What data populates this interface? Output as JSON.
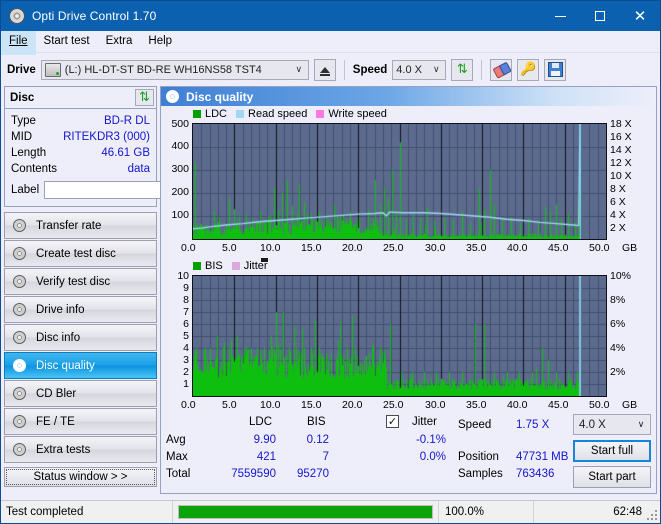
{
  "window": {
    "title": "Opti Drive Control 1.70",
    "icon": "disc-icon",
    "minimize": "—",
    "maximize": "□",
    "close": "✕"
  },
  "menu": {
    "items": [
      {
        "label": "File",
        "active": true
      },
      {
        "label": "Start test",
        "active": false
      },
      {
        "label": "Extra",
        "active": false
      },
      {
        "label": "Help",
        "active": false
      }
    ]
  },
  "toolbar": {
    "drive_label": "Drive",
    "drive_value": "(L:)   HL-DT-ST BD-RE  WH16NS58 TST4",
    "eject_title": "eject-button",
    "speed_label": "Speed",
    "speed_value": "4.0 X",
    "refresh_title": "refresh-button",
    "erase_title": "erase-button",
    "key_title": "key-button",
    "save_title": "save-button",
    "chevron": "∨"
  },
  "disc": {
    "header": "Disc",
    "refresh_title": "disc-refresh-button",
    "rows": [
      {
        "key": "Type",
        "value": "BD-R DL"
      },
      {
        "key": "MID",
        "value": "RITEKDR3 (000)"
      },
      {
        "key": "Length",
        "value": "46.61 GB"
      },
      {
        "key": "Contents",
        "value": "data"
      }
    ],
    "label_key": "Label",
    "label_value": "",
    "label_placeholder": ""
  },
  "nav": {
    "items": [
      {
        "label": "Transfer rate",
        "selected": false
      },
      {
        "label": "Create test disc",
        "selected": false
      },
      {
        "label": "Verify test disc",
        "selected": false
      },
      {
        "label": "Drive info",
        "selected": false
      },
      {
        "label": "Disc info",
        "selected": false
      },
      {
        "label": "Disc quality",
        "selected": true
      },
      {
        "label": "CD Bler",
        "selected": false
      },
      {
        "label": "FE / TE",
        "selected": false
      },
      {
        "label": "Extra tests",
        "selected": false
      }
    ],
    "status_button": "Status window > >"
  },
  "panel": {
    "title": "Disc quality"
  },
  "stats": {
    "col_ldc": "LDC",
    "col_bis": "BIS",
    "jitter_label": "Jitter",
    "jitter_checked": true,
    "jitter_check_glyph": "✓",
    "row_avg": "Avg",
    "row_max": "Max",
    "row_total": "Total",
    "avg_ldc": "9.90",
    "avg_bis": "0.12",
    "avg_jitter": "-0.1%",
    "max_ldc": "421",
    "max_bis": "7",
    "max_jitter": "0.0%",
    "total_ldc": "7559590",
    "total_bis": "95270",
    "speed_label": "Speed",
    "speed_value": "1.75 X",
    "position_label": "Position",
    "position_value": "47731 MB",
    "samples_label": "Samples",
    "samples_value": "763436",
    "speed_select": "4.0 X",
    "speed_select_chevron": "∨",
    "start_full": "Start full",
    "start_part": "Start part"
  },
  "statusbar": {
    "message": "Test completed",
    "percent": "100.0%",
    "percent_value": 100,
    "time": "62:48"
  },
  "colors": {
    "ldc": "#0fbf0f",
    "bis": "#0fbf0f",
    "read_speed": "#9fd8f5",
    "write_speed": "#ff79e0",
    "jitter": "#d8aadd",
    "plot_bg": "#5c6b8d",
    "grid": "#41506f",
    "grid_major": "#10101a",
    "title_bar": "#0b60b0",
    "accent": "#1515cd"
  },
  "chart_data": [
    {
      "id": "ldc-chart",
      "type": "area",
      "title": "LDC / Read speed",
      "legend": [
        {
          "label": "LDC",
          "color": "#00a000"
        },
        {
          "label": "Read speed",
          "color": "#9fd8f5"
        },
        {
          "label": "Write speed",
          "color": "#ff79e0"
        }
      ],
      "legend_position": "top-left",
      "xlabel": "GB",
      "xlim": [
        0,
        50
      ],
      "xticks": [
        "0.0",
        "5.0",
        "10.0",
        "15.0",
        "20.0",
        "25.0",
        "30.0",
        "35.0",
        "40.0",
        "45.0",
        "50.0"
      ],
      "ylabel_left": "LDC",
      "ylim": [
        0,
        500
      ],
      "yticks_left": [
        100,
        200,
        300,
        400,
        500
      ],
      "ylabel_right": "Speed",
      "ylim_right": [
        0,
        18
      ],
      "yticks_right": [
        "2 X",
        "4 X",
        "6 X",
        "8 X",
        "10 X",
        "12 X",
        "14 X",
        "16 X",
        "18 X"
      ],
      "data_end_gb": 46.8,
      "grid": true,
      "series": [
        {
          "name": "LDC",
          "color": "#0fbf0f",
          "kind": "spikes",
          "baseline_points": [
            {
              "x": 0.0,
              "y": 40
            },
            {
              "x": 2.0,
              "y": 42
            },
            {
              "x": 5.0,
              "y": 45
            },
            {
              "x": 8.0,
              "y": 48
            },
            {
              "x": 11.0,
              "y": 50
            },
            {
              "x": 14.0,
              "y": 52
            },
            {
              "x": 17.0,
              "y": 52
            },
            {
              "x": 20.0,
              "y": 55
            },
            {
              "x": 22.5,
              "y": 58
            },
            {
              "x": 23.2,
              "y": 20
            },
            {
              "x": 26.0,
              "y": 16
            },
            {
              "x": 30.0,
              "y": 15
            },
            {
              "x": 35.0,
              "y": 16
            },
            {
              "x": 40.0,
              "y": 14
            },
            {
              "x": 44.0,
              "y": 14
            },
            {
              "x": 46.8,
              "y": 12
            }
          ],
          "peaks": [
            {
              "x": 0.3,
              "y": 335
            },
            {
              "x": 2.6,
              "y": 120
            },
            {
              "x": 3.1,
              "y": 95
            },
            {
              "x": 4.4,
              "y": 175
            },
            {
              "x": 5.0,
              "y": 130
            },
            {
              "x": 5.6,
              "y": 98
            },
            {
              "x": 6.4,
              "y": 110
            },
            {
              "x": 7.2,
              "y": 90
            },
            {
              "x": 8.1,
              "y": 120
            },
            {
              "x": 9.1,
              "y": 100
            },
            {
              "x": 9.8,
              "y": 225
            },
            {
              "x": 10.3,
              "y": 120
            },
            {
              "x": 10.8,
              "y": 200
            },
            {
              "x": 11.4,
              "y": 258
            },
            {
              "x": 12.0,
              "y": 145
            },
            {
              "x": 12.6,
              "y": 105
            },
            {
              "x": 13.4,
              "y": 160
            },
            {
              "x": 14.3,
              "y": 112
            },
            {
              "x": 15.2,
              "y": 120
            },
            {
              "x": 16.1,
              "y": 98
            },
            {
              "x": 17.1,
              "y": 148
            },
            {
              "x": 18.2,
              "y": 102
            },
            {
              "x": 19.0,
              "y": 118
            },
            {
              "x": 20.1,
              "y": 96
            },
            {
              "x": 21.2,
              "y": 130
            },
            {
              "x": 22.0,
              "y": 255
            },
            {
              "x": 22.6,
              "y": 150
            },
            {
              "x": 23.1,
              "y": 222
            },
            {
              "x": 23.6,
              "y": 175
            },
            {
              "x": 24.1,
              "y": 298
            },
            {
              "x": 24.6,
              "y": 120
            },
            {
              "x": 25.1,
              "y": 420
            },
            {
              "x": 25.8,
              "y": 88
            },
            {
              "x": 26.6,
              "y": 105
            },
            {
              "x": 27.5,
              "y": 92
            },
            {
              "x": 28.3,
              "y": 140
            },
            {
              "x": 29.2,
              "y": 80
            },
            {
              "x": 30.4,
              "y": 95
            },
            {
              "x": 31.5,
              "y": 82
            },
            {
              "x": 32.6,
              "y": 120
            },
            {
              "x": 33.5,
              "y": 70
            },
            {
              "x": 34.6,
              "y": 220
            },
            {
              "x": 35.2,
              "y": 128
            },
            {
              "x": 35.9,
              "y": 300
            },
            {
              "x": 36.5,
              "y": 150
            },
            {
              "x": 37.4,
              "y": 85
            },
            {
              "x": 38.5,
              "y": 95
            },
            {
              "x": 39.6,
              "y": 70
            },
            {
              "x": 40.6,
              "y": 88
            },
            {
              "x": 41.8,
              "y": 76
            },
            {
              "x": 42.6,
              "y": 140
            },
            {
              "x": 43.2,
              "y": 118
            },
            {
              "x": 43.9,
              "y": 150
            },
            {
              "x": 44.6,
              "y": 90
            },
            {
              "x": 45.4,
              "y": 110
            },
            {
              "x": 46.2,
              "y": 75
            },
            {
              "x": 46.7,
              "y": 300
            }
          ]
        },
        {
          "name": "Read speed",
          "color": "#9fd8f5",
          "kind": "line",
          "points": [
            {
              "x": 0.0,
              "y": 1.6
            },
            {
              "x": 1.0,
              "y": 1.7
            },
            {
              "x": 2.0,
              "y": 1.9
            },
            {
              "x": 4.0,
              "y": 2.2
            },
            {
              "x": 6.0,
              "y": 2.4
            },
            {
              "x": 8.0,
              "y": 2.7
            },
            {
              "x": 10.0,
              "y": 2.9
            },
            {
              "x": 12.0,
              "y": 3.1
            },
            {
              "x": 14.0,
              "y": 3.3
            },
            {
              "x": 16.0,
              "y": 3.5
            },
            {
              "x": 18.0,
              "y": 3.7
            },
            {
              "x": 20.0,
              "y": 3.9
            },
            {
              "x": 22.0,
              "y": 4.0
            },
            {
              "x": 23.0,
              "y": 4.1
            },
            {
              "x": 23.4,
              "y": 3.6
            },
            {
              "x": 23.8,
              "y": 4.2
            },
            {
              "x": 25.5,
              "y": 4.1
            },
            {
              "x": 28.0,
              "y": 4.1
            },
            {
              "x": 30.0,
              "y": 4.0
            },
            {
              "x": 32.0,
              "y": 3.8
            },
            {
              "x": 34.0,
              "y": 3.6
            },
            {
              "x": 36.0,
              "y": 3.4
            },
            {
              "x": 38.0,
              "y": 3.1
            },
            {
              "x": 40.0,
              "y": 2.9
            },
            {
              "x": 42.0,
              "y": 2.6
            },
            {
              "x": 44.0,
              "y": 2.4
            },
            {
              "x": 46.0,
              "y": 2.2
            },
            {
              "x": 46.7,
              "y": 2.1
            },
            {
              "x": 46.85,
              "y": 18.0
            }
          ]
        }
      ]
    },
    {
      "id": "bis-chart",
      "type": "area",
      "title": "BIS / Jitter",
      "legend": [
        {
          "label": "BIS",
          "color": "#00a000"
        },
        {
          "label": "Jitter",
          "color": "#d8aadd"
        }
      ],
      "legend_position": "top-left",
      "xlabel": "GB",
      "xlim": [
        0,
        50
      ],
      "xticks": [
        "0.0",
        "5.0",
        "10.0",
        "15.0",
        "20.0",
        "25.0",
        "30.0",
        "35.0",
        "40.0",
        "45.0",
        "50.0"
      ],
      "ylabel_left": "BIS",
      "ylim": [
        0,
        10
      ],
      "yticks_left": [
        1,
        2,
        3,
        4,
        5,
        6,
        7,
        8,
        9,
        10
      ],
      "ylabel_right": "Jitter",
      "ylim_right": [
        0,
        10
      ],
      "yticks_right": [
        "2%",
        "4%",
        "6%",
        "8%",
        "10%"
      ],
      "data_end_gb": 46.8,
      "grid": true,
      "series": [
        {
          "name": "BIS",
          "color": "#0fbf0f",
          "kind": "spikes",
          "baseline_points": [
            {
              "x": 0.0,
              "y": 2.6
            },
            {
              "x": 5.0,
              "y": 2.7
            },
            {
              "x": 10.0,
              "y": 2.8
            },
            {
              "x": 15.0,
              "y": 2.6
            },
            {
              "x": 20.0,
              "y": 2.5
            },
            {
              "x": 23.2,
              "y": 2.6
            },
            {
              "x": 23.5,
              "y": 1.0
            },
            {
              "x": 30.0,
              "y": 1.0
            },
            {
              "x": 40.0,
              "y": 1.0
            },
            {
              "x": 46.8,
              "y": 1.0
            }
          ],
          "peaks": [
            {
              "x": 0.4,
              "y": 4
            },
            {
              "x": 1.4,
              "y": 4
            },
            {
              "x": 2.1,
              "y": 4
            },
            {
              "x": 2.9,
              "y": 5
            },
            {
              "x": 3.6,
              "y": 4
            },
            {
              "x": 4.3,
              "y": 4
            },
            {
              "x": 5.3,
              "y": 5
            },
            {
              "x": 6.2,
              "y": 4
            },
            {
              "x": 7.0,
              "y": 4
            },
            {
              "x": 7.8,
              "y": 4
            },
            {
              "x": 8.6,
              "y": 4
            },
            {
              "x": 9.4,
              "y": 5
            },
            {
              "x": 10.0,
              "y": 7
            },
            {
              "x": 10.9,
              "y": 7
            },
            {
              "x": 11.6,
              "y": 4
            },
            {
              "x": 12.5,
              "y": 4
            },
            {
              "x": 13.4,
              "y": 4
            },
            {
              "x": 14.3,
              "y": 4
            },
            {
              "x": 15.3,
              "y": 4
            },
            {
              "x": 16.3,
              "y": 3
            },
            {
              "x": 17.4,
              "y": 3
            },
            {
              "x": 18.6,
              "y": 4
            },
            {
              "x": 19.6,
              "y": 4
            },
            {
              "x": 20.7,
              "y": 3
            },
            {
              "x": 21.7,
              "y": 4
            },
            {
              "x": 22.6,
              "y": 4
            },
            {
              "x": 23.9,
              "y": 6
            },
            {
              "x": 25.2,
              "y": 2
            },
            {
              "x": 26.5,
              "y": 2
            },
            {
              "x": 28.0,
              "y": 2
            },
            {
              "x": 29.4,
              "y": 2
            },
            {
              "x": 31.0,
              "y": 2
            },
            {
              "x": 32.6,
              "y": 2
            },
            {
              "x": 34.2,
              "y": 6
            },
            {
              "x": 35.2,
              "y": 6
            },
            {
              "x": 36.4,
              "y": 2
            },
            {
              "x": 38.0,
              "y": 2
            },
            {
              "x": 39.5,
              "y": 2
            },
            {
              "x": 41.0,
              "y": 2
            },
            {
              "x": 42.2,
              "y": 4
            },
            {
              "x": 43.0,
              "y": 3
            },
            {
              "x": 44.0,
              "y": 2
            },
            {
              "x": 45.4,
              "y": 2
            },
            {
              "x": 46.5,
              "y": 2
            }
          ]
        },
        {
          "name": "Jitter",
          "color": "#9fd8f5",
          "kind": "line",
          "points": [
            {
              "x": 46.85,
              "y": 10.0
            },
            {
              "x": 46.85,
              "y": 0.0
            }
          ]
        }
      ]
    }
  ]
}
